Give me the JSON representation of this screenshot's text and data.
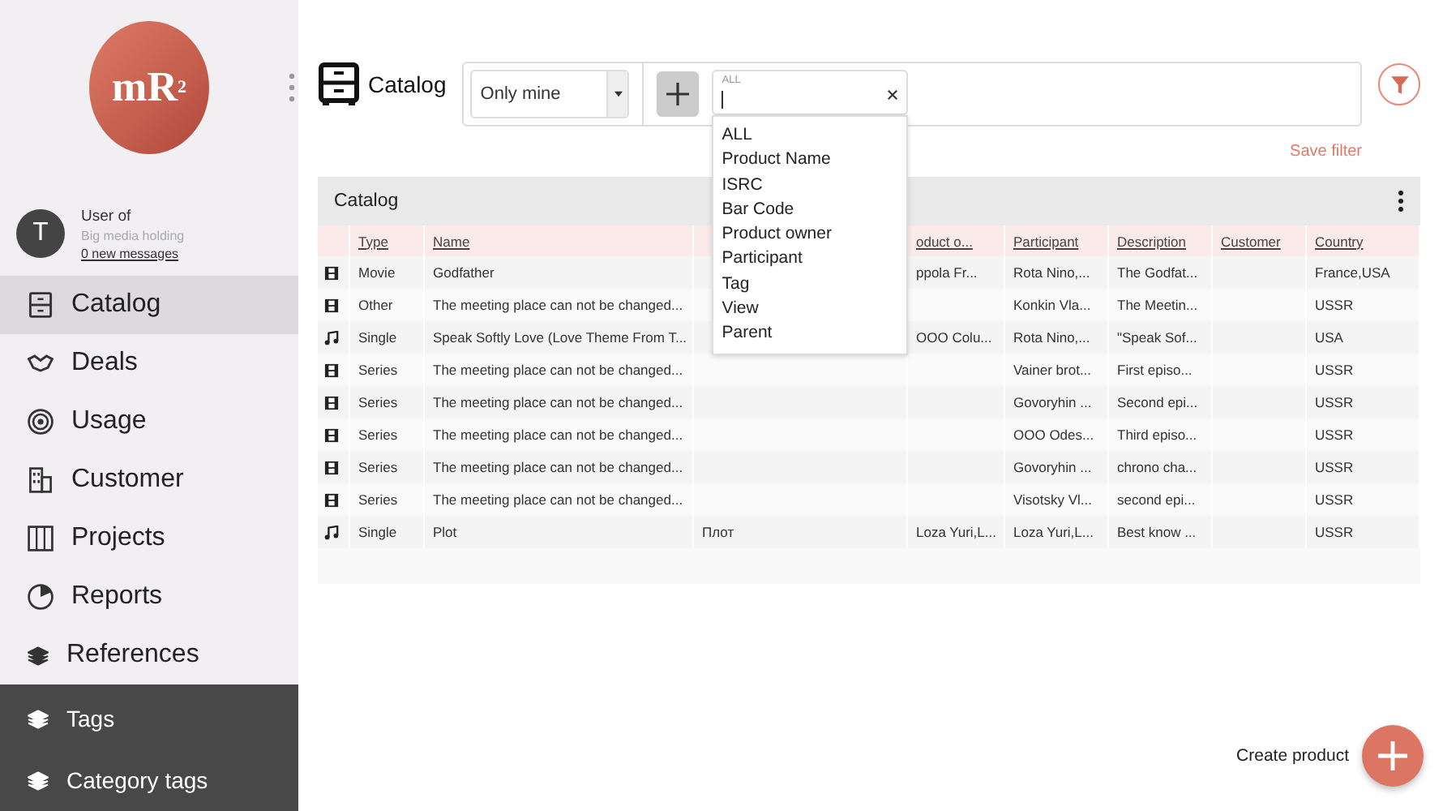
{
  "logo": {
    "text": "mR",
    "sup": "2"
  },
  "user": {
    "initial": "T",
    "name": "User of",
    "company": "Big media holding",
    "messages": "0 new messages"
  },
  "nav": [
    {
      "label": "Catalog",
      "selected": true
    },
    {
      "label": "Deals",
      "selected": false
    },
    {
      "label": "Usage",
      "selected": false
    },
    {
      "label": "Customer",
      "selected": false
    },
    {
      "label": "Projects",
      "selected": false
    },
    {
      "label": "Reports",
      "selected": false
    },
    {
      "label": "References",
      "selected": false,
      "expanded": true,
      "children": [
        {
          "label": "Tags"
        },
        {
          "label": "Category tags"
        }
      ]
    }
  ],
  "header": {
    "title": "Catalog",
    "scope": "Only mine",
    "filter_label": "ALL",
    "save_filter": "Save filter"
  },
  "dropdown": [
    "ALL",
    "Product Name",
    "ISRC",
    "Bar Code",
    "Product owner",
    "Participant",
    "Tag",
    "View",
    "Parent"
  ],
  "table": {
    "title": "Catalog",
    "columns": [
      "Type",
      "Name",
      "",
      "oduct o...",
      "Participant",
      "Description",
      "Customer",
      "Country"
    ],
    "rows": [
      {
        "kind": "film",
        "cells": [
          "Movie",
          "Godfather",
          "",
          "ppola Fr...",
          "Rota Nino,...",
          "The Godfat...",
          "",
          "France,USA"
        ]
      },
      {
        "kind": "film",
        "cells": [
          "Other",
          "The meeting place can not be changed...",
          "",
          "",
          "Konkin Vla...",
          "The Meetin...",
          "",
          "USSR"
        ]
      },
      {
        "kind": "music",
        "cells": [
          "Single",
          "Speak Softly Love (Love Theme From T...",
          "",
          "OOO Colu...",
          "Rota Nino,...",
          "\"Speak Sof...",
          "",
          "USA"
        ]
      },
      {
        "kind": "film",
        "cells": [
          "Series",
          "The meeting place can not be changed...",
          "",
          "",
          "Vainer brot...",
          "First episo...",
          "",
          "USSR"
        ]
      },
      {
        "kind": "film",
        "cells": [
          "Series",
          "The meeting place can not be changed...",
          "",
          "",
          "Govoryhin ...",
          "Second epi...",
          "",
          "USSR"
        ]
      },
      {
        "kind": "film",
        "cells": [
          "Series",
          "The meeting place can not be changed...",
          "",
          "",
          "OOO Odes...",
          "Third episo...",
          "",
          "USSR"
        ]
      },
      {
        "kind": "film",
        "cells": [
          "Series",
          "The meeting place can not be changed...",
          "",
          "",
          "Govoryhin ...",
          "chrono cha...",
          "",
          "USSR"
        ]
      },
      {
        "kind": "film",
        "cells": [
          "Series",
          "The meeting place can not be changed...",
          "",
          "",
          "Visotsky Vl...",
          "second epi...",
          "",
          "USSR"
        ]
      },
      {
        "kind": "music",
        "cells": [
          "Single",
          "Plot",
          "Плот",
          "Loza Yuri,L...",
          "Loza Yuri,L...",
          "Best know ...",
          "",
          "USSR"
        ]
      }
    ]
  },
  "create": {
    "label": "Create product"
  }
}
